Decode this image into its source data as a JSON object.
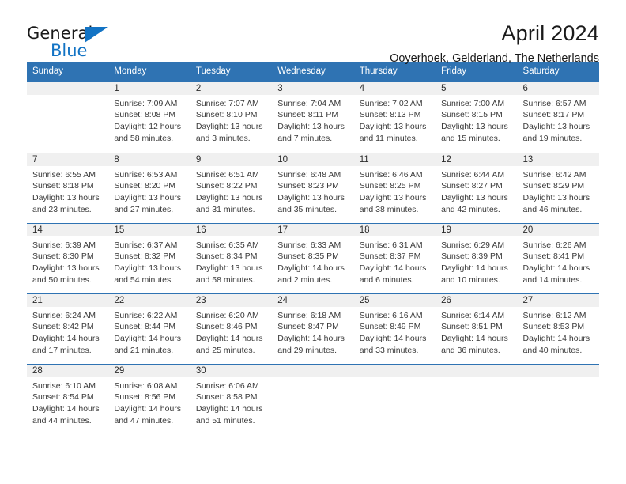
{
  "brand": {
    "line1": "General",
    "line2": "Blue",
    "accent_color": "#1273c4",
    "triangle_icon": "triangle-icon"
  },
  "header": {
    "title": "April 2024",
    "subtitle": "Ooyerhoek, Gelderland, The Netherlands"
  },
  "calendar": {
    "header_bg": "#2f73b3",
    "header_text_color": "#ffffff",
    "daynum_bg": "#f0f0f0",
    "weekday_labels": [
      "Sunday",
      "Monday",
      "Tuesday",
      "Wednesday",
      "Thursday",
      "Friday",
      "Saturday"
    ],
    "weeks": [
      [
        {
          "day": "",
          "sunrise": "",
          "sunset": "",
          "daylight_1": "",
          "daylight_2": ""
        },
        {
          "day": "1",
          "sunrise": "Sunrise: 7:09 AM",
          "sunset": "Sunset: 8:08 PM",
          "daylight_1": "Daylight: 12 hours",
          "daylight_2": "and 58 minutes."
        },
        {
          "day": "2",
          "sunrise": "Sunrise: 7:07 AM",
          "sunset": "Sunset: 8:10 PM",
          "daylight_1": "Daylight: 13 hours",
          "daylight_2": "and 3 minutes."
        },
        {
          "day": "3",
          "sunrise": "Sunrise: 7:04 AM",
          "sunset": "Sunset: 8:11 PM",
          "daylight_1": "Daylight: 13 hours",
          "daylight_2": "and 7 minutes."
        },
        {
          "day": "4",
          "sunrise": "Sunrise: 7:02 AM",
          "sunset": "Sunset: 8:13 PM",
          "daylight_1": "Daylight: 13 hours",
          "daylight_2": "and 11 minutes."
        },
        {
          "day": "5",
          "sunrise": "Sunrise: 7:00 AM",
          "sunset": "Sunset: 8:15 PM",
          "daylight_1": "Daylight: 13 hours",
          "daylight_2": "and 15 minutes."
        },
        {
          "day": "6",
          "sunrise": "Sunrise: 6:57 AM",
          "sunset": "Sunset: 8:17 PM",
          "daylight_1": "Daylight: 13 hours",
          "daylight_2": "and 19 minutes."
        }
      ],
      [
        {
          "day": "7",
          "sunrise": "Sunrise: 6:55 AM",
          "sunset": "Sunset: 8:18 PM",
          "daylight_1": "Daylight: 13 hours",
          "daylight_2": "and 23 minutes."
        },
        {
          "day": "8",
          "sunrise": "Sunrise: 6:53 AM",
          "sunset": "Sunset: 8:20 PM",
          "daylight_1": "Daylight: 13 hours",
          "daylight_2": "and 27 minutes."
        },
        {
          "day": "9",
          "sunrise": "Sunrise: 6:51 AM",
          "sunset": "Sunset: 8:22 PM",
          "daylight_1": "Daylight: 13 hours",
          "daylight_2": "and 31 minutes."
        },
        {
          "day": "10",
          "sunrise": "Sunrise: 6:48 AM",
          "sunset": "Sunset: 8:23 PM",
          "daylight_1": "Daylight: 13 hours",
          "daylight_2": "and 35 minutes."
        },
        {
          "day": "11",
          "sunrise": "Sunrise: 6:46 AM",
          "sunset": "Sunset: 8:25 PM",
          "daylight_1": "Daylight: 13 hours",
          "daylight_2": "and 38 minutes."
        },
        {
          "day": "12",
          "sunrise": "Sunrise: 6:44 AM",
          "sunset": "Sunset: 8:27 PM",
          "daylight_1": "Daylight: 13 hours",
          "daylight_2": "and 42 minutes."
        },
        {
          "day": "13",
          "sunrise": "Sunrise: 6:42 AM",
          "sunset": "Sunset: 8:29 PM",
          "daylight_1": "Daylight: 13 hours",
          "daylight_2": "and 46 minutes."
        }
      ],
      [
        {
          "day": "14",
          "sunrise": "Sunrise: 6:39 AM",
          "sunset": "Sunset: 8:30 PM",
          "daylight_1": "Daylight: 13 hours",
          "daylight_2": "and 50 minutes."
        },
        {
          "day": "15",
          "sunrise": "Sunrise: 6:37 AM",
          "sunset": "Sunset: 8:32 PM",
          "daylight_1": "Daylight: 13 hours",
          "daylight_2": "and 54 minutes."
        },
        {
          "day": "16",
          "sunrise": "Sunrise: 6:35 AM",
          "sunset": "Sunset: 8:34 PM",
          "daylight_1": "Daylight: 13 hours",
          "daylight_2": "and 58 minutes."
        },
        {
          "day": "17",
          "sunrise": "Sunrise: 6:33 AM",
          "sunset": "Sunset: 8:35 PM",
          "daylight_1": "Daylight: 14 hours",
          "daylight_2": "and 2 minutes."
        },
        {
          "day": "18",
          "sunrise": "Sunrise: 6:31 AM",
          "sunset": "Sunset: 8:37 PM",
          "daylight_1": "Daylight: 14 hours",
          "daylight_2": "and 6 minutes."
        },
        {
          "day": "19",
          "sunrise": "Sunrise: 6:29 AM",
          "sunset": "Sunset: 8:39 PM",
          "daylight_1": "Daylight: 14 hours",
          "daylight_2": "and 10 minutes."
        },
        {
          "day": "20",
          "sunrise": "Sunrise: 6:26 AM",
          "sunset": "Sunset: 8:41 PM",
          "daylight_1": "Daylight: 14 hours",
          "daylight_2": "and 14 minutes."
        }
      ],
      [
        {
          "day": "21",
          "sunrise": "Sunrise: 6:24 AM",
          "sunset": "Sunset: 8:42 PM",
          "daylight_1": "Daylight: 14 hours",
          "daylight_2": "and 17 minutes."
        },
        {
          "day": "22",
          "sunrise": "Sunrise: 6:22 AM",
          "sunset": "Sunset: 8:44 PM",
          "daylight_1": "Daylight: 14 hours",
          "daylight_2": "and 21 minutes."
        },
        {
          "day": "23",
          "sunrise": "Sunrise: 6:20 AM",
          "sunset": "Sunset: 8:46 PM",
          "daylight_1": "Daylight: 14 hours",
          "daylight_2": "and 25 minutes."
        },
        {
          "day": "24",
          "sunrise": "Sunrise: 6:18 AM",
          "sunset": "Sunset: 8:47 PM",
          "daylight_1": "Daylight: 14 hours",
          "daylight_2": "and 29 minutes."
        },
        {
          "day": "25",
          "sunrise": "Sunrise: 6:16 AM",
          "sunset": "Sunset: 8:49 PM",
          "daylight_1": "Daylight: 14 hours",
          "daylight_2": "and 33 minutes."
        },
        {
          "day": "26",
          "sunrise": "Sunrise: 6:14 AM",
          "sunset": "Sunset: 8:51 PM",
          "daylight_1": "Daylight: 14 hours",
          "daylight_2": "and 36 minutes."
        },
        {
          "day": "27",
          "sunrise": "Sunrise: 6:12 AM",
          "sunset": "Sunset: 8:53 PM",
          "daylight_1": "Daylight: 14 hours",
          "daylight_2": "and 40 minutes."
        }
      ],
      [
        {
          "day": "28",
          "sunrise": "Sunrise: 6:10 AM",
          "sunset": "Sunset: 8:54 PM",
          "daylight_1": "Daylight: 14 hours",
          "daylight_2": "and 44 minutes."
        },
        {
          "day": "29",
          "sunrise": "Sunrise: 6:08 AM",
          "sunset": "Sunset: 8:56 PM",
          "daylight_1": "Daylight: 14 hours",
          "daylight_2": "and 47 minutes."
        },
        {
          "day": "30",
          "sunrise": "Sunrise: 6:06 AM",
          "sunset": "Sunset: 8:58 PM",
          "daylight_1": "Daylight: 14 hours",
          "daylight_2": "and 51 minutes."
        },
        {
          "day": "",
          "sunrise": "",
          "sunset": "",
          "daylight_1": "",
          "daylight_2": ""
        },
        {
          "day": "",
          "sunrise": "",
          "sunset": "",
          "daylight_1": "",
          "daylight_2": ""
        },
        {
          "day": "",
          "sunrise": "",
          "sunset": "",
          "daylight_1": "",
          "daylight_2": ""
        },
        {
          "day": "",
          "sunrise": "",
          "sunset": "",
          "daylight_1": "",
          "daylight_2": ""
        }
      ]
    ]
  }
}
